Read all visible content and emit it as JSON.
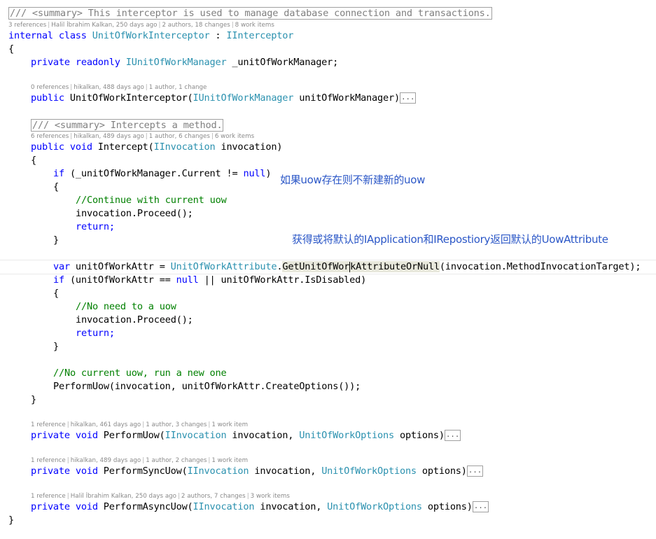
{
  "summary_class": "/// <summary> This interceptor is used to manage database connection and transactions.",
  "lens_class": [
    "3 references",
    "Halil İbrahim Kalkan, 250 days ago",
    "2 authors, 18 changes",
    "8 work items"
  ],
  "class_decl": {
    "kw": "internal class",
    "name": "UnitOfWorkInterceptor",
    "colon": " : ",
    "base": "IInterceptor"
  },
  "brace_open": "{",
  "brace_close": "}",
  "field": {
    "kw": "private readonly",
    "type": "IUnitOfWorkManager",
    "name": " _unitOfWorkManager;"
  },
  "lens_ctor": [
    "0 references",
    "hikalkan, 488 days ago",
    "1 author, 1 change"
  ],
  "ctor": {
    "kw": "public",
    "name": " UnitOfWorkInterceptor(",
    "ptype": "IUnitOfWorkManager",
    "pname": " unitOfWorkManager)",
    "fold": "..."
  },
  "summary_method": "/// <summary> Intercepts a method.",
  "lens_intercept": [
    "6 references",
    "hikalkan, 489 days ago",
    "1 author, 6 changes",
    "6 work items"
  ],
  "intercept": {
    "kw": "public void",
    "name": " Intercept(",
    "ptype": "IInvocation",
    "pname": " invocation)"
  },
  "if1": {
    "kw": "if",
    "cond": " (_unitOfWorkManager.Current != ",
    "nul": "null",
    "end": ")"
  },
  "comment_continue": "//Continue with current uow",
  "proceed": "invocation.Proceed();",
  "return_kw": "return;",
  "var_line": {
    "kw": "var",
    "rest": " unitOfWorkAttr = ",
    "type": "UnitOfWorkAttribute",
    "dot": ".",
    "method_a": "GetUnitOfWor",
    "method_b": "kAttributeOrNull",
    "args": "(invocation.MethodInvocationTarget);"
  },
  "if2": {
    "kw": "if",
    "a": " (unitOfWorkAttr == ",
    "nul": "null",
    "b": " || unitOfWorkAttr.IsDisabled)"
  },
  "comment_noneed": "//No need to a uow",
  "comment_nocurrent": "//No current uow, run a new one",
  "perform_call": "PerformUow(invocation, unitOfWorkAttr.CreateOptions());",
  "lens_perform": [
    "1 reference",
    "hikalkan, 461 days ago",
    "1 author, 3 changes",
    "1 work item"
  ],
  "perform": {
    "kw": "private void",
    "name": " PerformUow(",
    "t1": "IInvocation",
    "p1": " invocation, ",
    "t2": "UnitOfWorkOptions",
    "p2": " options)",
    "fold": "..."
  },
  "lens_sync": [
    "1 reference",
    "hikalkan, 489 days ago",
    "1 author, 2 changes",
    "1 work item"
  ],
  "sync": {
    "kw": "private void",
    "name": " PerformSyncUow(",
    "t1": "IInvocation",
    "p1": " invocation, ",
    "t2": "UnitOfWorkOptions",
    "p2": " options)",
    "fold": "..."
  },
  "lens_async": [
    "1 reference",
    "Halil İbrahim Kalkan, 250 days ago",
    "2 authors, 7 changes",
    "3 work items"
  ],
  "async": {
    "kw": "private void",
    "name": " PerformAsyncUow(",
    "t1": "IInvocation",
    "p1": " invocation, ",
    "t2": "UnitOfWorkOptions",
    "p2": " options)",
    "fold": "..."
  },
  "annotations": {
    "note1": "如果uow存在则不新建新的uow",
    "note2": "获得或将默认的IApplication和IRepostiory返回默认的UowAttribute"
  },
  "colors": {
    "keyword": "#0000ff",
    "type": "#2b91af",
    "comment": "#008000",
    "annotation": "#2b57c7"
  }
}
